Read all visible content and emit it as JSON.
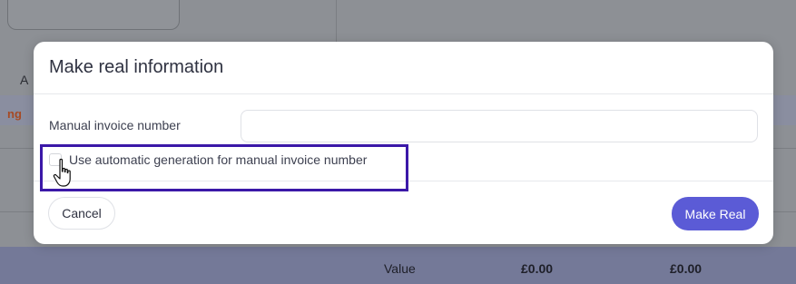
{
  "background": {
    "row_label_a": "A",
    "row_label_ng": "ng",
    "footer": {
      "label": "Value",
      "value_1": "£0.00",
      "value_2": "£0.00"
    }
  },
  "modal": {
    "title": "Make real information",
    "manual_invoice_label": "Manual invoice number",
    "manual_invoice_value": "",
    "auto_generation_label": "Use automatic generation for manual invoice number",
    "auto_generation_checked": false,
    "cancel_label": "Cancel",
    "make_real_label": "Make Real"
  },
  "colors": {
    "primary_button": "#5b5bd6",
    "highlight_border": "#3b18a8"
  },
  "icons": {
    "cursor": "hand-pointer-icon"
  }
}
